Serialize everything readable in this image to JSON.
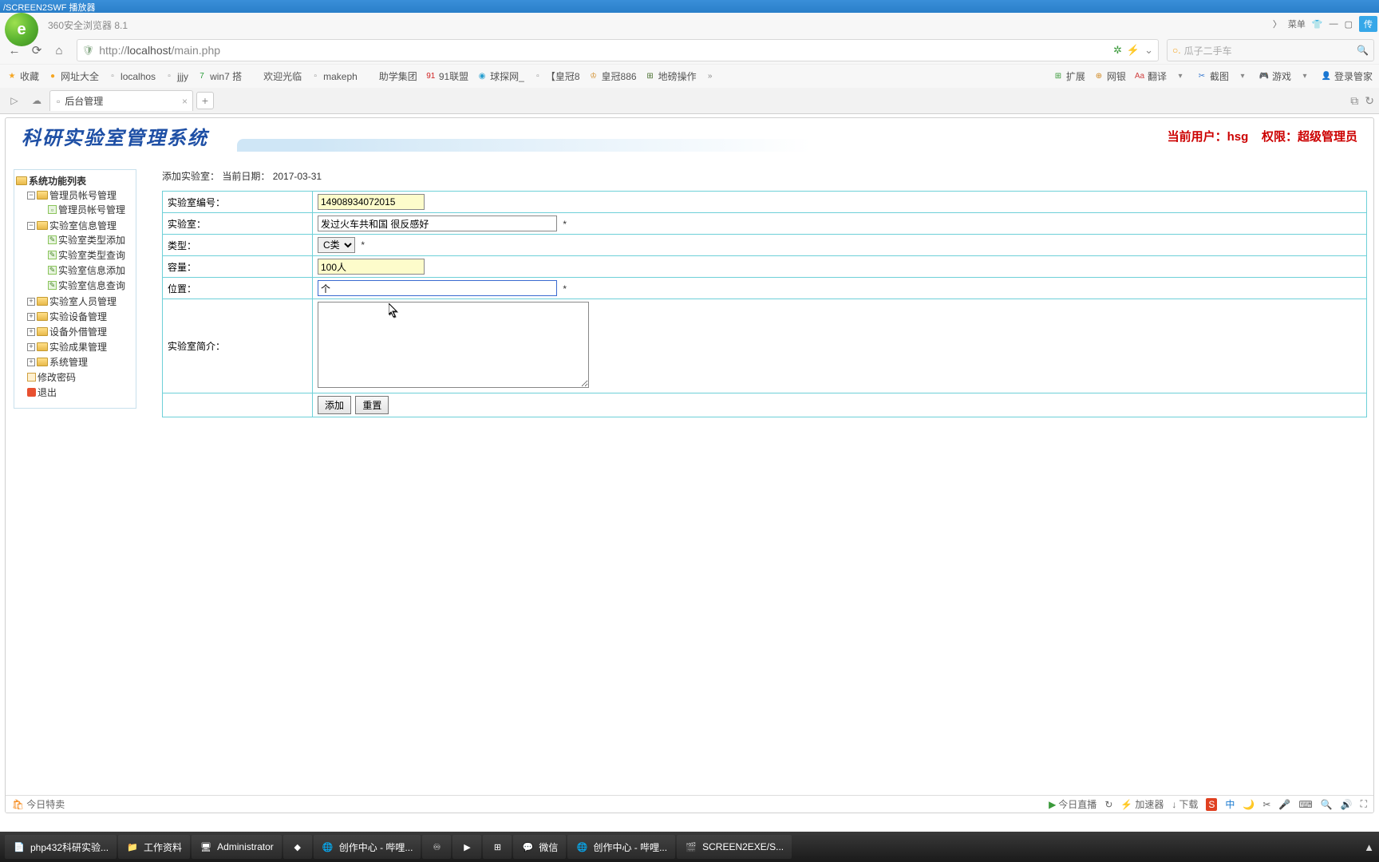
{
  "window": {
    "title": "/SCREEN2SWF 播放器"
  },
  "browser": {
    "name": "360安全浏览器 8.1",
    "url_prefix": "http://",
    "url_host": "localhost",
    "url_path": "/main.php",
    "search_placeholder": "瓜子二手车",
    "top_menu": [
      "菜单"
    ],
    "ext_badge": "传",
    "bookmarks_left": [
      {
        "icon": "★",
        "label": "收藏",
        "color": "#f5a623"
      },
      {
        "icon": "●",
        "label": "网址大全",
        "color": "#f5a623"
      },
      {
        "icon": "▫",
        "label": "localhos",
        "color": "#888"
      },
      {
        "icon": "▫",
        "label": "jjjy",
        "color": "#888"
      },
      {
        "icon": "7",
        "label": "win7 搭",
        "color": "#2a9d3a"
      },
      {
        "icon": "",
        "label": "欢迎光临",
        "color": "#888"
      },
      {
        "icon": "▫",
        "label": "makeph",
        "color": "#888"
      },
      {
        "icon": "",
        "label": "助学集团",
        "color": "#888"
      },
      {
        "icon": "91",
        "label": "91联盟",
        "color": "#d02020"
      },
      {
        "icon": "◉",
        "label": "球探网_",
        "color": "#2aa0d0"
      },
      {
        "icon": "▫",
        "label": "【皇冠8",
        "color": "#888"
      },
      {
        "icon": "♔",
        "label": "皇冠886",
        "color": "#d08820"
      },
      {
        "icon": "⊞",
        "label": "地磅操作",
        "color": "#4a7030"
      },
      {
        "icon": "»",
        "label": "",
        "color": "#888"
      }
    ],
    "bookmarks_right": [
      {
        "icon": "⊞",
        "label": "扩展",
        "color": "#3a9a3a"
      },
      {
        "icon": "⊕",
        "label": "网银",
        "color": "#d08820"
      },
      {
        "icon": "Aa",
        "label": "翻译",
        "color": "#d04040"
      },
      {
        "icon": "▾",
        "label": "",
        "color": "#888"
      },
      {
        "icon": "✂",
        "label": "截图",
        "color": "#3a7ad0"
      },
      {
        "icon": "▾",
        "label": "",
        "color": "#888"
      },
      {
        "icon": "🎮",
        "label": "游戏",
        "color": "#6a50c0"
      },
      {
        "icon": "▾",
        "label": "",
        "color": "#888"
      },
      {
        "icon": "👤",
        "label": "登录管家",
        "color": "#3a7ad0"
      }
    ],
    "tab": {
      "title": "后台管理"
    }
  },
  "app": {
    "title": "科研实验室管理系统",
    "user_label": "当前用户：",
    "user_value": "hsg",
    "role_label": "权限：",
    "role_value": "超级管理员"
  },
  "tree": {
    "root": "系统功能列表",
    "nodes": [
      {
        "label": "管理员帐号管理",
        "expanded": true,
        "children": [
          {
            "label": "管理员帐号管理",
            "leaf": true
          }
        ]
      },
      {
        "label": "实验室信息管理",
        "expanded": true,
        "children": [
          {
            "label": "实验室类型添加",
            "leaf": true,
            "pencil": true
          },
          {
            "label": "实验室类型查询",
            "leaf": true,
            "pencil": true
          },
          {
            "label": "实验室信息添加",
            "leaf": true,
            "pencil": true
          },
          {
            "label": "实验室信息查询",
            "leaf": true,
            "pencil": true
          }
        ]
      },
      {
        "label": "实验室人员管理",
        "expanded": false
      },
      {
        "label": "实验设备管理",
        "expanded": false
      },
      {
        "label": "设备外借管理",
        "expanded": false
      },
      {
        "label": "实验成果管理",
        "expanded": false
      },
      {
        "label": "系统管理",
        "expanded": false
      },
      {
        "label": "修改密码",
        "leaf": true,
        "key": true
      },
      {
        "label": "退出",
        "leaf": true,
        "stop": true
      }
    ]
  },
  "form": {
    "heading": "添加实验室：  当前日期：",
    "date": "2017-03-31",
    "rows": {
      "id_label": "实验室编号：",
      "id_value": "14908934072015",
      "name_label": "实验室：",
      "name_value": "发过火车共和国 很反感好",
      "type_label": "类型：",
      "type_value": "C类",
      "cap_label": "容量：",
      "cap_value": "100人",
      "loc_label": "位置：",
      "loc_value": "个",
      "desc_label": "实验室简介：",
      "desc_value": ""
    },
    "required": "*",
    "add_btn": "添加",
    "reset_btn": "重置"
  },
  "statusbar": {
    "left": "今日特卖",
    "right": [
      "今日直播",
      "加速器",
      "下载"
    ]
  },
  "taskbar": {
    "items": [
      {
        "icon": "📄",
        "label": "php432科研实验..."
      },
      {
        "icon": "📁",
        "label": "工作资料"
      },
      {
        "icon": "🖥",
        "label": "Administrator"
      },
      {
        "icon": "◆",
        "label": ""
      },
      {
        "icon": "🌐",
        "label": "创作中心 - 哔哩..."
      },
      {
        "icon": "♾",
        "label": ""
      },
      {
        "icon": "▶",
        "label": ""
      },
      {
        "icon": "⊞",
        "label": ""
      },
      {
        "icon": "💬",
        "label": "微信"
      },
      {
        "icon": "🌐",
        "label": "创作中心 - 哔哩..."
      },
      {
        "icon": "🎬",
        "label": "SCREEN2EXE/S..."
      }
    ]
  }
}
